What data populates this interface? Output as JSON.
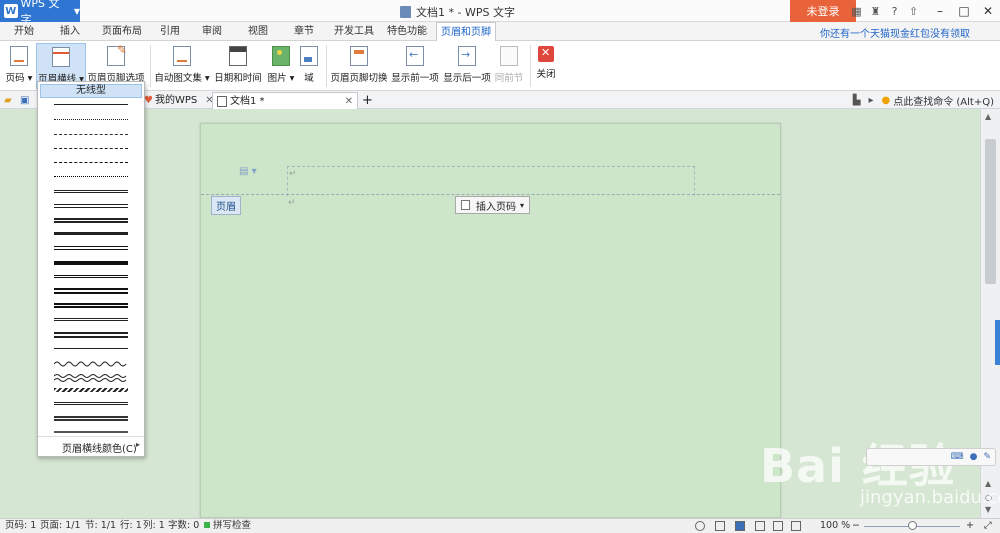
{
  "titlebar": {
    "app_name": "WPS 文字",
    "app_logo": "W",
    "doc_title": "文档1 * - WPS 文字",
    "login": "未登录",
    "icons": [
      "skin-icon",
      "shirt-icon",
      "help-icon",
      "pin-icon"
    ],
    "help": "?",
    "win": [
      "–",
      "□",
      "✕"
    ]
  },
  "tabs": [
    "开始",
    "插入",
    "页面布局",
    "引用",
    "审阅",
    "视图",
    "章节",
    "开发工具",
    "特色功能",
    "页眉和页脚"
  ],
  "active_tab": "页眉和页脚",
  "promo": "你还有一个天猫现金红包没有领取",
  "ribbon": {
    "page_number": "页码",
    "header_line": "页眉横线",
    "header_footer_options": "页眉页脚选项",
    "auto_text": "自动图文集",
    "date_time": "日期和时间",
    "picture": "图片",
    "field": "域",
    "switch": "页眉页脚切换",
    "show_prev": "显示前一项",
    "show_next": "显示后一项",
    "same_as_prev": "同前节",
    "close": "关闭"
  },
  "doc_tabs": {
    "tab1": "我的WPS",
    "tab2": "文档1 *",
    "find_cmd": "点此查找命令 (Alt+Q)"
  },
  "dropdown": {
    "none": "无线型",
    "color": "页眉横线颜色(C)"
  },
  "document": {
    "header_tag": "页眉",
    "insert_page_number": "插入页码",
    "para_mark": "↵"
  },
  "status": {
    "page_num": "页码: 1",
    "pages": "页面: 1/1",
    "section": "节: 1/1",
    "line": "行: 1",
    "col": "列: 1",
    "words": "字数: 0",
    "spell": "拼写检查",
    "zoom": "100 %",
    "zoom_fraction": 0.5
  },
  "watermark": {
    "main": "Bai 经验",
    "sub": "jingyan.baidu.com"
  }
}
